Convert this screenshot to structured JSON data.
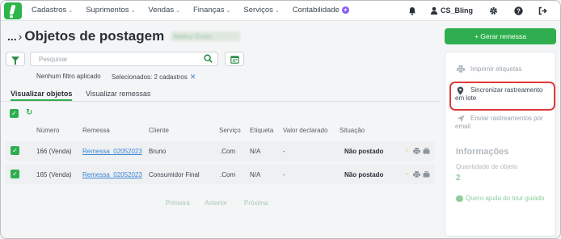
{
  "nav": {
    "items": [
      {
        "label": "Cadastros",
        "has_chevron": true
      },
      {
        "label": "Suprimentos",
        "has_chevron": true
      },
      {
        "label": "Vendas",
        "has_chevron": true
      },
      {
        "label": "Finanças",
        "has_chevron": true
      },
      {
        "label": "Serviços",
        "has_chevron": true
      },
      {
        "label": "Contabilidade",
        "has_chevron": false,
        "badge": "star-icon"
      }
    ],
    "user": "CS_Bling",
    "icons": [
      "bell-icon",
      "user-icon",
      "gear-icon",
      "help-icon",
      "logout-icon"
    ],
    "accent": "#2db44a"
  },
  "header": {
    "ellipsis": "...",
    "title": "Objetos de postagem",
    "account_blurred": "Melhor Envio"
  },
  "sidebar": {
    "primary_button": "+ Gerar remessa",
    "actions": [
      {
        "label": "Imprimir etiquetas",
        "icon": "printer-icon",
        "state": "disabled"
      },
      {
        "label": "Sincronizar rastreamento em lote",
        "icon": "location-pin-icon",
        "state": "highlighted"
      },
      {
        "label": "Enviar rastreamentos por email",
        "icon": "send-icon",
        "state": "disabled"
      }
    ],
    "info_title": "Informações",
    "info_label": "Quantidade de objeto",
    "info_value": "2",
    "help_link": "Quero ajuda do tour guiado",
    "highlight_color": "#e03a3a"
  },
  "filters": {
    "search_placeholder": "Pesquisar",
    "search_value": "",
    "filter_status": "Nenhum filtro aplicado",
    "selected_status": "Selecionados: 2 cadastros",
    "clear_symbol": "✕"
  },
  "tabs": [
    {
      "label": "Visualizar objetos",
      "active": true
    },
    {
      "label": "Visualizar remessas",
      "active": false
    }
  ],
  "table": {
    "columns": [
      "Número",
      "Remessa",
      "Cliente",
      "Serviço",
      "Etiqueta",
      "Valor declarado",
      "Situação"
    ],
    "rows": [
      {
        "numero": "166 (Venda)",
        "remessa": "Remessa_02052023",
        "cliente": "Bruno",
        "servico": ".Com",
        "etiqueta": "N/A",
        "valor": "-",
        "situacao": "Não postado",
        "checked": true
      },
      {
        "numero": "165 (Venda)",
        "remessa": "Remessa_02052023",
        "cliente": "Consumidor Final",
        "servico": ".Com",
        "etiqueta": "N/A",
        "valor": "-",
        "situacao": "Não postado",
        "checked": true
      }
    ],
    "row_action_icons": [
      "loading-icon",
      "printer-icon",
      "briefcase-icon"
    ]
  },
  "pagination": {
    "first": "Primeira",
    "previous": "Anterior",
    "next": "Próxima"
  }
}
